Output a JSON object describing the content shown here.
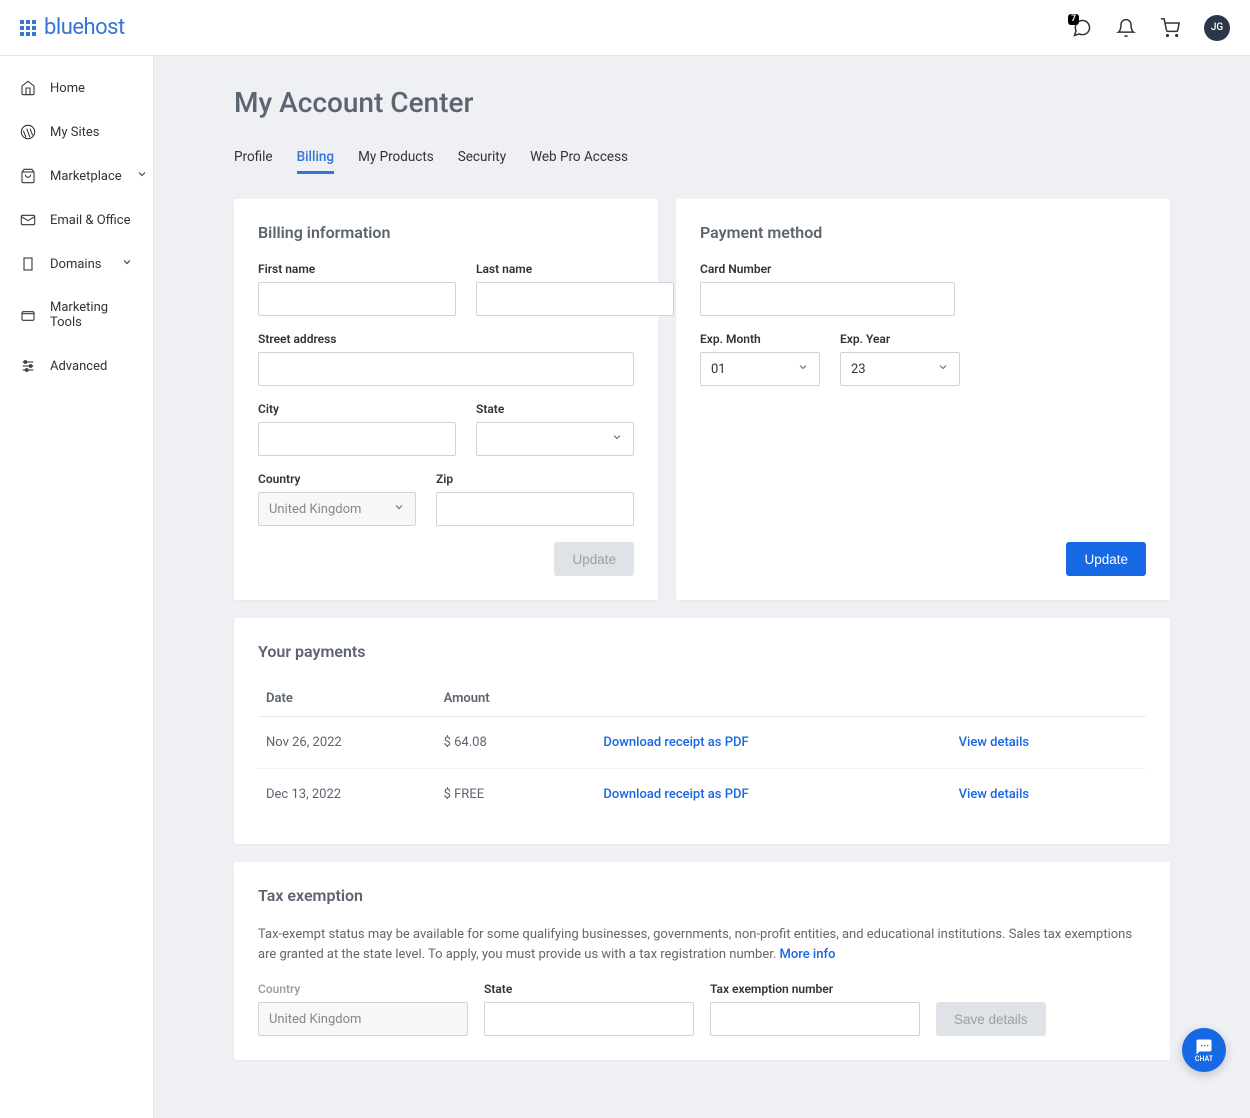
{
  "brand": "bluehost",
  "header": {
    "messages_badge": "7",
    "avatar_initials": "JG"
  },
  "sidebar": {
    "items": [
      {
        "label": "Home"
      },
      {
        "label": "My Sites"
      },
      {
        "label": "Marketplace"
      },
      {
        "label": "Email & Office"
      },
      {
        "label": "Domains"
      },
      {
        "label": "Marketing Tools"
      },
      {
        "label": "Advanced"
      }
    ]
  },
  "page_title": "My Account Center",
  "tabs": [
    {
      "label": "Profile"
    },
    {
      "label": "Billing"
    },
    {
      "label": "My Products"
    },
    {
      "label": "Security"
    },
    {
      "label": "Web Pro Access"
    }
  ],
  "billing_card": {
    "title": "Billing information",
    "labels": {
      "first_name": "First name",
      "last_name": "Last name",
      "street": "Street address",
      "city": "City",
      "state": "State",
      "country": "Country",
      "zip": "Zip"
    },
    "country_value": "United Kingdom",
    "update_label": "Update"
  },
  "payment_card": {
    "title": "Payment method",
    "labels": {
      "card_number": "Card Number",
      "exp_month": "Exp. Month",
      "exp_year": "Exp. Year"
    },
    "exp_month_value": "01",
    "exp_year_value": "23",
    "update_label": "Update"
  },
  "payments_card": {
    "title": "Your payments",
    "columns": {
      "date": "Date",
      "amount": "Amount"
    },
    "download_label": "Download receipt as PDF",
    "view_label": "View details",
    "rows": [
      {
        "date": "Nov 26, 2022",
        "amount": "$ 64.08"
      },
      {
        "date": "Dec 13, 2022",
        "amount": "$ FREE"
      }
    ]
  },
  "tax_card": {
    "title": "Tax exemption",
    "description": "Tax-exempt status may be available for some qualifying businesses, governments, non-profit entities, and educational institutions. Sales tax exemptions are granted at the state level. To apply, you must provide us with a tax registration number. ",
    "more_info": "More info",
    "labels": {
      "country": "Country",
      "state": "State",
      "tax_number": "Tax exemption number"
    },
    "country_value": "United Kingdom",
    "save_label": "Save details"
  },
  "chat_label": "CHAT"
}
